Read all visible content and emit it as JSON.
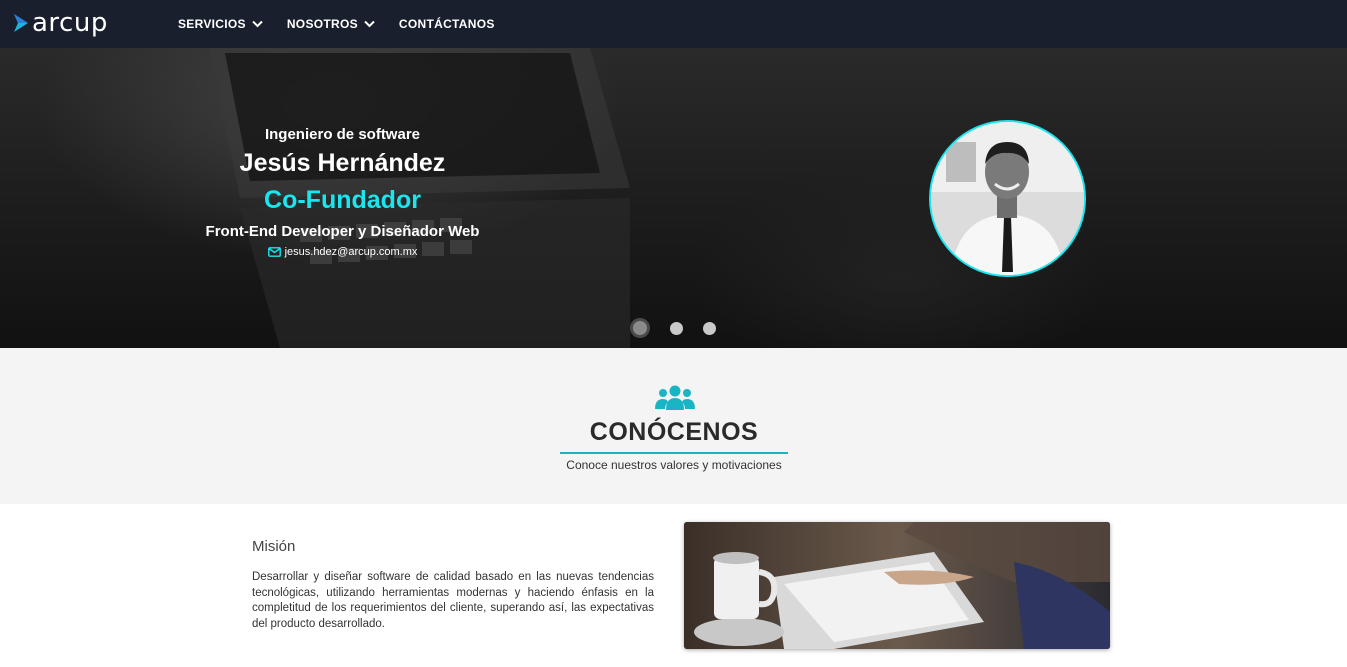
{
  "brand": {
    "logo_text": "arcup",
    "accent": "#19e6ef",
    "nav_bg": "#1a1f2e"
  },
  "nav": {
    "items": [
      {
        "label": "SERVICIOS",
        "has_dropdown": true
      },
      {
        "label": "NOSOTROS",
        "has_dropdown": true
      },
      {
        "label": "CONTÁCTANOS",
        "has_dropdown": false
      }
    ]
  },
  "hero": {
    "role": "Ingeniero de software",
    "name": "Jesús Hernández",
    "position": "Co-Fundador",
    "description": "Front-End Developer y Diseñador Web",
    "email": "jesus.hdez@arcup.com.mx",
    "carousel": {
      "total": 3,
      "active": 1
    }
  },
  "about": {
    "icon": "users-icon",
    "title": "CONÓCENOS",
    "subtitle": "Conoce nuestros valores y motivaciones"
  },
  "mission": {
    "title": "Misión",
    "text": "Desarrollar y diseñar software de calidad basado en las nuevas tendencias tecnológicas, utilizando herramientas modernas y haciendo énfasis en la completitud de los requerimientos del cliente, superando así, las expectativas del producto desarrollado."
  }
}
